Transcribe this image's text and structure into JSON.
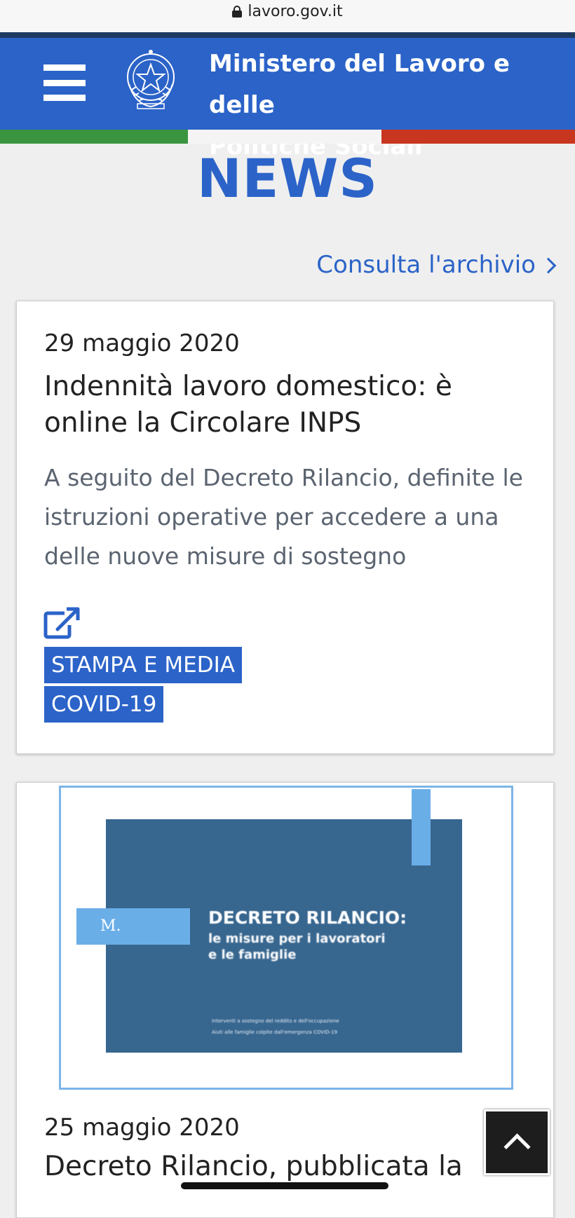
{
  "browser": {
    "url": "lavoro.gov.it",
    "lock_icon": "lock-icon"
  },
  "header": {
    "title_line1": "Ministero del Lavoro e delle",
    "title_line2": "Politiche Sociali",
    "menu_icon": "hamburger-menu-icon",
    "emblem_icon": "italian-republic-emblem-icon",
    "color": "#2b63c8"
  },
  "tricolore": {
    "green": "#3a9440",
    "white": "#f4f4f4",
    "red": "#c8361f"
  },
  "page": {
    "title": "NEWS"
  },
  "archive": {
    "label": "Consulta l'archivio",
    "icon": "chevron-right-icon"
  },
  "articles": [
    {
      "date": "29 maggio 2020",
      "title": "Indennità lavoro domestico: è online la Circolare INPS",
      "summary": "A seguito del Decreto Rilancio, definite le istruzioni operative per accedere a una delle nuove misure di sostegno",
      "link_icon": "external-link-icon",
      "tags": [
        "STAMPA E MEDIA",
        "COVID-19"
      ]
    },
    {
      "image": {
        "logo_text": "M.",
        "title": "DECRETO RILANCIO:",
        "subtitle_line1": "le misure per i lavoratori",
        "subtitle_line2": "e le famiglie",
        "small_line1": "Interventi a sostegno del reddito e dell'occupazione",
        "small_line2": "Aiuti alle famiglie colpite dall'emergenza COVID-19"
      },
      "date": "25 maggio 2020",
      "title": "Decreto Rilancio, pubblicata la"
    }
  ],
  "scroll_top": {
    "icon": "chevron-up-icon"
  }
}
